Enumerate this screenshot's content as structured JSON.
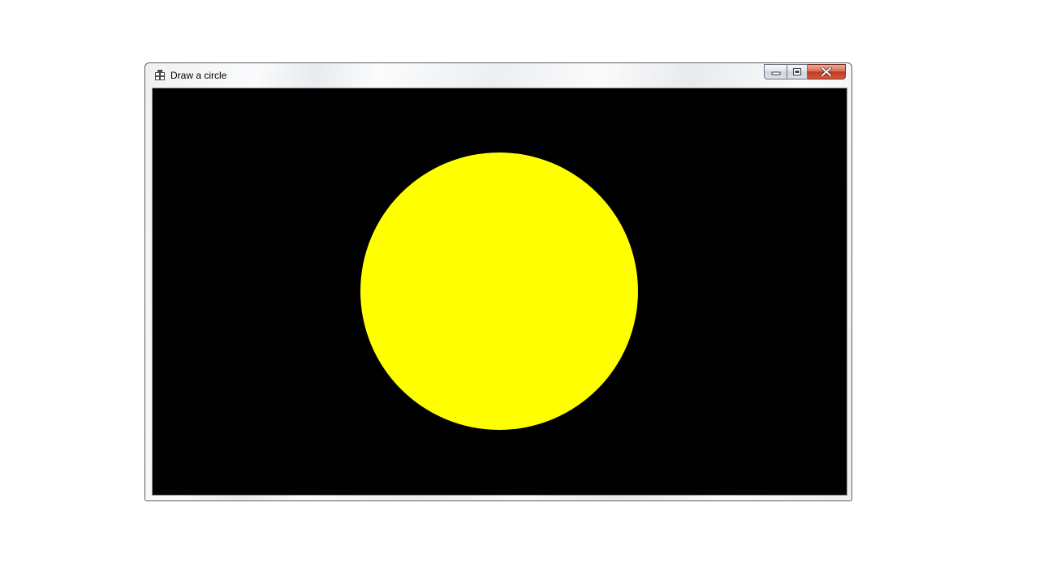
{
  "window": {
    "title": "Draw a circle",
    "icon": "app-window-icon",
    "buttons": {
      "minimize_icon": "minimize-icon",
      "maximize_icon": "restore-icon",
      "close_icon": "close-icon"
    }
  },
  "canvas": {
    "background_color": "#000000",
    "shape": "circle",
    "fill_color": "#ffff00"
  }
}
